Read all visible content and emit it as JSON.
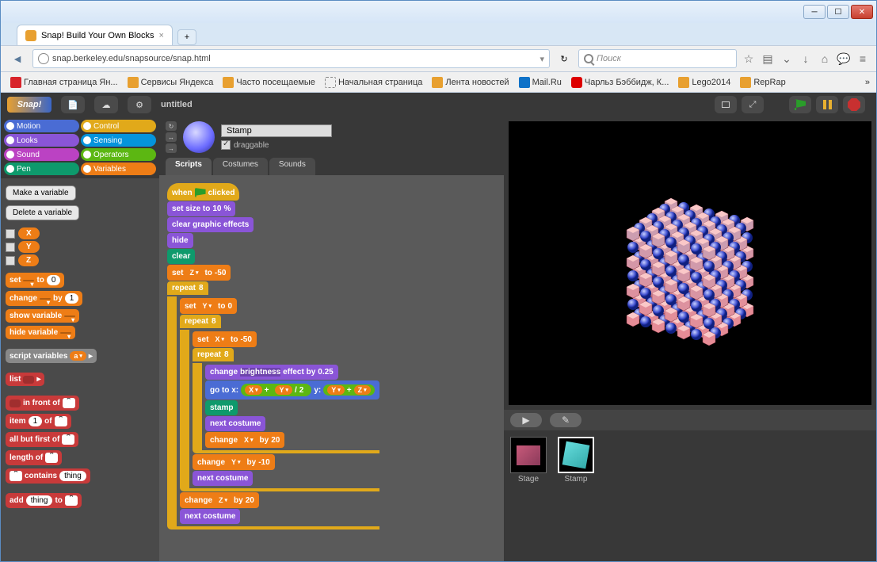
{
  "window": {
    "tab_title": "Snap! Build Your Own Blocks",
    "tab_add": "+"
  },
  "browser": {
    "url": "snap.berkeley.edu/snapsource/snap.html",
    "search_placeholder": "Поиск",
    "bookmarks": [
      {
        "label": "Главная страница Ян...",
        "ico": "y"
      },
      {
        "label": "Сервисы Яндекса",
        "ico": "o"
      },
      {
        "label": "Часто посещаемые",
        "ico": "b"
      },
      {
        "label": "Начальная страница",
        "ico": "g"
      },
      {
        "label": "Лента новостей",
        "ico": "o"
      },
      {
        "label": "Mail.Ru",
        "ico": "m"
      },
      {
        "label": "Чарльз Бэббидж, К...",
        "ico": "r"
      },
      {
        "label": "Lego2014",
        "ico": "o"
      },
      {
        "label": "RepRap",
        "ico": "o"
      }
    ],
    "bm_more": "»"
  },
  "snap": {
    "logo": "Snap!",
    "title": "untitled",
    "categories": [
      {
        "name": "Motion",
        "cls": "c-motion"
      },
      {
        "name": "Control",
        "cls": "c-control"
      },
      {
        "name": "Looks",
        "cls": "c-looks"
      },
      {
        "name": "Sensing",
        "cls": "c-sensing"
      },
      {
        "name": "Sound",
        "cls": "c-sound"
      },
      {
        "name": "Operators",
        "cls": "c-operators"
      },
      {
        "name": "Pen",
        "cls": "c-pen"
      },
      {
        "name": "Variables",
        "cls": "c-variables"
      }
    ],
    "palette": {
      "make_var": "Make a variable",
      "del_var": "Delete a variable",
      "vars": [
        "X",
        "Y",
        "Z"
      ],
      "blocks": {
        "set": "set",
        "to": "to",
        "set_v": "0",
        "change": "change",
        "by": "by",
        "change_v": "1",
        "show": "show variable",
        "hide": "hide variable",
        "scriptvars": "script variables",
        "sv_a": "a",
        "list": "list",
        "infront": "in front of",
        "item": "item",
        "item_i": "1",
        "of": "of",
        "allbut": "all but first of",
        "length": "length of",
        "contains": "contains",
        "thing": "thing",
        "add": "add",
        "to2": "to"
      }
    },
    "sprite": {
      "name": "Stamp",
      "draggable": "draggable",
      "tabs": [
        "Scripts",
        "Costumes",
        "Sounds"
      ]
    },
    "script": {
      "when_clicked": "when",
      "clicked": "clicked",
      "set_size": "set size to",
      "size_v": "10",
      "pct": "%",
      "clear_fx": "clear graphic effects",
      "hide": "hide",
      "clear": "clear",
      "set": "set",
      "to": "to",
      "z": "Z",
      "y": "Y",
      "x": "X",
      "v_m50": "-50",
      "v_0": "0",
      "v_8": "8",
      "repeat": "repeat",
      "change_eff": "change",
      "brightness": "brightness",
      "effect_by": "effect by",
      "eff_v": "0.25",
      "goto": "go to x:",
      "gy": "y:",
      "slash": "/",
      "two": "2",
      "plus": "+",
      "stamp": "stamp",
      "next_costume": "next costume",
      "change": "change",
      "by": "by",
      "v_20": "20",
      "v_m10": "-10"
    },
    "corral": {
      "play": "▶",
      "brush": "✎",
      "stage": "Stage",
      "stamp": "Stamp"
    }
  }
}
